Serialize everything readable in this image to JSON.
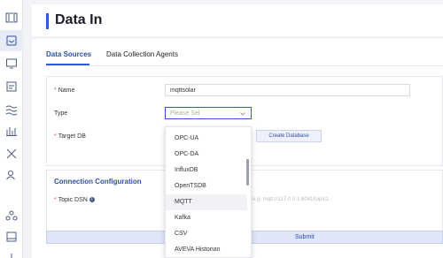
{
  "page": {
    "title": "Data In"
  },
  "tabs": [
    {
      "label": "Data Sources",
      "active": true
    },
    {
      "label": "Data Collection Agents",
      "active": false
    }
  ],
  "form": {
    "name_label": "Name",
    "name_value": "mqttsolar",
    "type_label": "Type",
    "type_placeholder": "Please Sel",
    "target_label": "Target DB",
    "create_db_label": "Create Database",
    "section_title": "Connection Configuration",
    "dsn_label": "Topic DSN",
    "dsn_hint": "e.g. mqtt://127.0.0.1:8041/topic1",
    "required_mark": "*",
    "info_glyph": "i"
  },
  "dropdown": {
    "options": [
      "OPC-UA",
      "OPC-DA",
      "InfluxDB",
      "OpenTSDB",
      "MQTT",
      "Kafka",
      "CSV",
      "AVEVA Historian"
    ],
    "highlighted": "MQTT"
  },
  "submit_label": "Submit",
  "colors": {
    "accent": "#2f5bd6",
    "required": "#e14b4b"
  }
}
